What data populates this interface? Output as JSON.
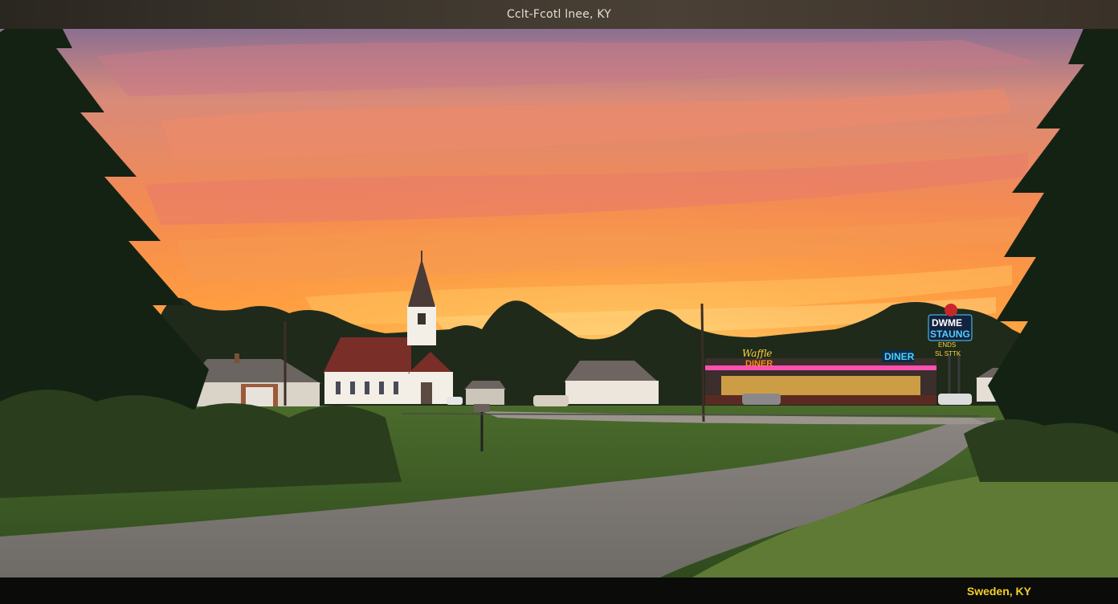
{
  "header": {
    "title": "Cclt-Fcotl lnee, KY"
  },
  "footer": {
    "caption": "Sweden, KY"
  },
  "signs": {
    "diner_left": "Waffle",
    "diner_left_sub": "DINER",
    "diner_roof": "DINER",
    "pole_sign_line1": "DWME",
    "pole_sign_line2": "STAUNG",
    "pole_sign_line3": "ENDS",
    "pole_sign_line4": "SL STTK"
  },
  "colors": {
    "sky_top": "#8d6a8a",
    "sky_mid": "#f1884f",
    "sky_horizon": "#ffb43c",
    "neon_pink": "#ff4fb0",
    "neon_blue": "#4fd0ff",
    "caption_yellow": "#f2cf2a"
  }
}
